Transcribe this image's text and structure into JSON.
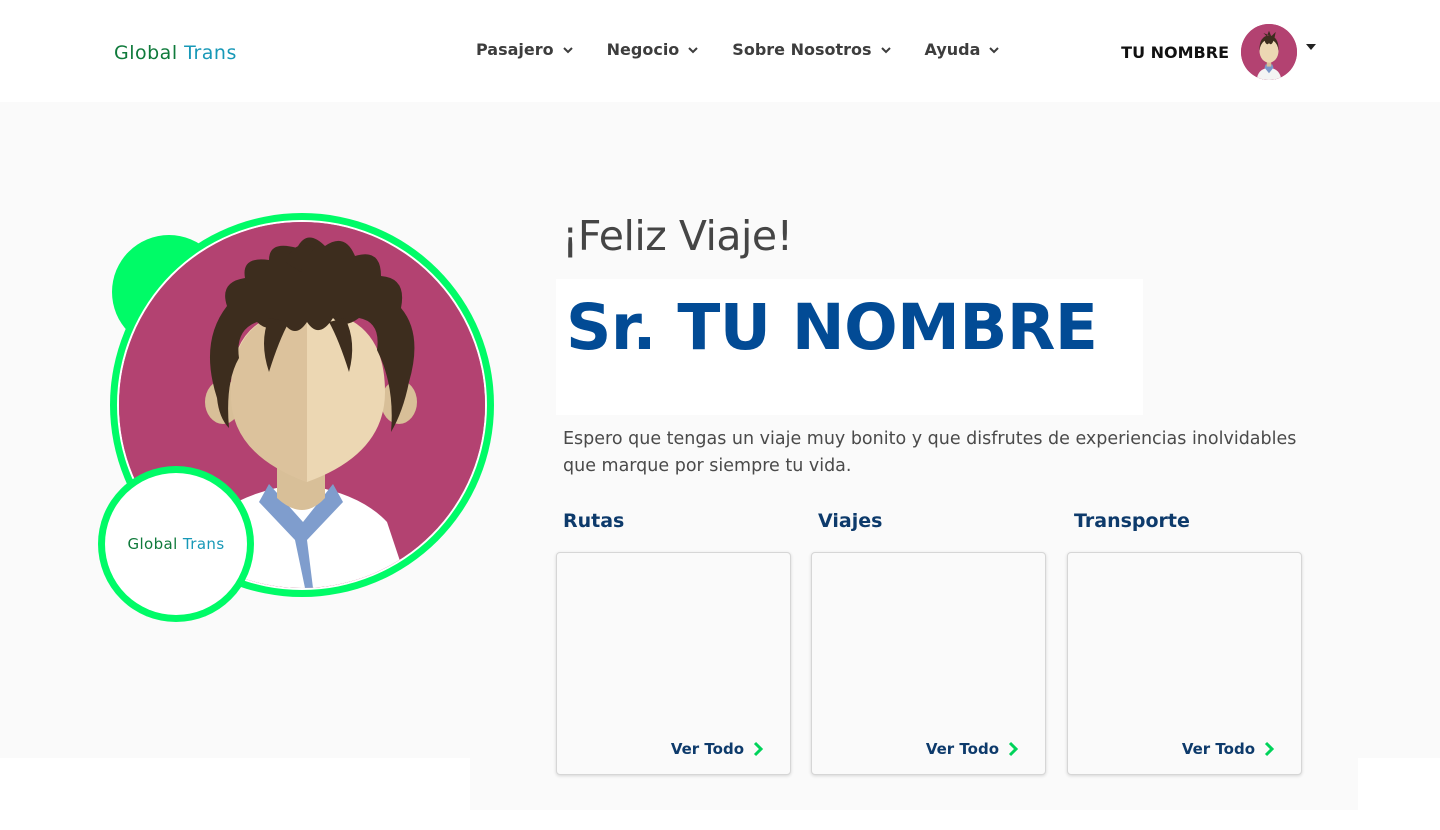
{
  "header": {
    "logo": {
      "part1": "Global",
      "part2": "Trans"
    },
    "nav": [
      {
        "label": "Pasajero"
      },
      {
        "label": "Negocio"
      },
      {
        "label": "Sobre Nosotros"
      },
      {
        "label": "Ayuda"
      }
    ],
    "user": {
      "name": "TU NOMBRE"
    }
  },
  "hero": {
    "greeting": "¡Feliz Viaje!",
    "name": "Sr. TU NOMBRE",
    "description": "Espero que tengas un viaje muy bonito y que disfrutes de experiencias inolvidables que marque por siempre tu vida.",
    "badge_logo": {
      "part1": "Global",
      "part2": "Trans"
    },
    "sections": [
      {
        "title": "Rutas",
        "link": "Ver Todo"
      },
      {
        "title": "Viajes",
        "link": "Ver Todo"
      },
      {
        "title": "Transporte",
        "link": "Ver Todo"
      }
    ]
  },
  "colors": {
    "brand_green": "#00fb67",
    "brand_blue": "#024b95",
    "avatar_bg": "#b34271",
    "link_chevron": "#00d35a"
  }
}
